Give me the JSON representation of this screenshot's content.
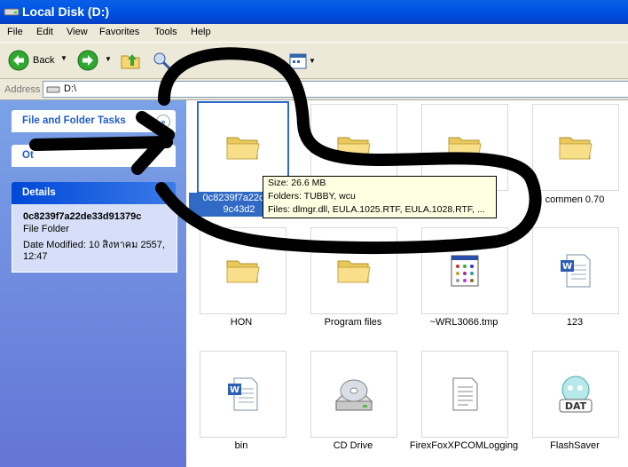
{
  "window": {
    "title": "Local Disk (D:)"
  },
  "menu": [
    "File",
    "Edit",
    "View",
    "Favorites",
    "Tools",
    "Help"
  ],
  "toolbar": {
    "back_label": "Back"
  },
  "address": {
    "label": "Address",
    "value": "D:\\"
  },
  "left_pane": {
    "tasks_title": "File and Folder Tasks",
    "other_title_partial": "Ot",
    "details_title": "Details",
    "details": {
      "name": "0c8239f7a22de33d91379c",
      "type": "File Folder",
      "date_modified": "Date Modified: 10 สิงหาคม 2557, 12:47"
    }
  },
  "items": [
    {
      "label": "0c8239f7a22de33d91379c9c43d2",
      "icon": "folder-icon",
      "selected": true
    },
    {
      "label": "",
      "icon": "folder-icon"
    },
    {
      "label": "",
      "icon": "folder-icon"
    },
    {
      "label": "commen 0.70",
      "icon": "folder-icon"
    },
    {
      "label": "HON",
      "icon": "folder-icon"
    },
    {
      "label": "Program files",
      "icon": "folder-icon"
    },
    {
      "label": "~WRL3066.tmp",
      "icon": "tmp-file-icon"
    },
    {
      "label": "123",
      "icon": "word-doc-icon"
    },
    {
      "label": "bin",
      "icon": "word-doc-icon"
    },
    {
      "label": "CD Drive",
      "icon": "cd-drive-icon"
    },
    {
      "label": "FirexFoxXPCOMLogging",
      "icon": "text-file-icon"
    },
    {
      "label": "FlashSaver",
      "icon": "dat-file-icon"
    }
  ],
  "selection": {
    "line1": "0c8239f7a22de3",
    "line2": "9c43d2"
  },
  "tooltip": {
    "size": "Size: 26.6 MB",
    "folders": "Folders: TUBBY, wcu",
    "files": "Files: dlmgr.dll, EULA.1025.RTF, EULA.1028.RTF, ..."
  }
}
